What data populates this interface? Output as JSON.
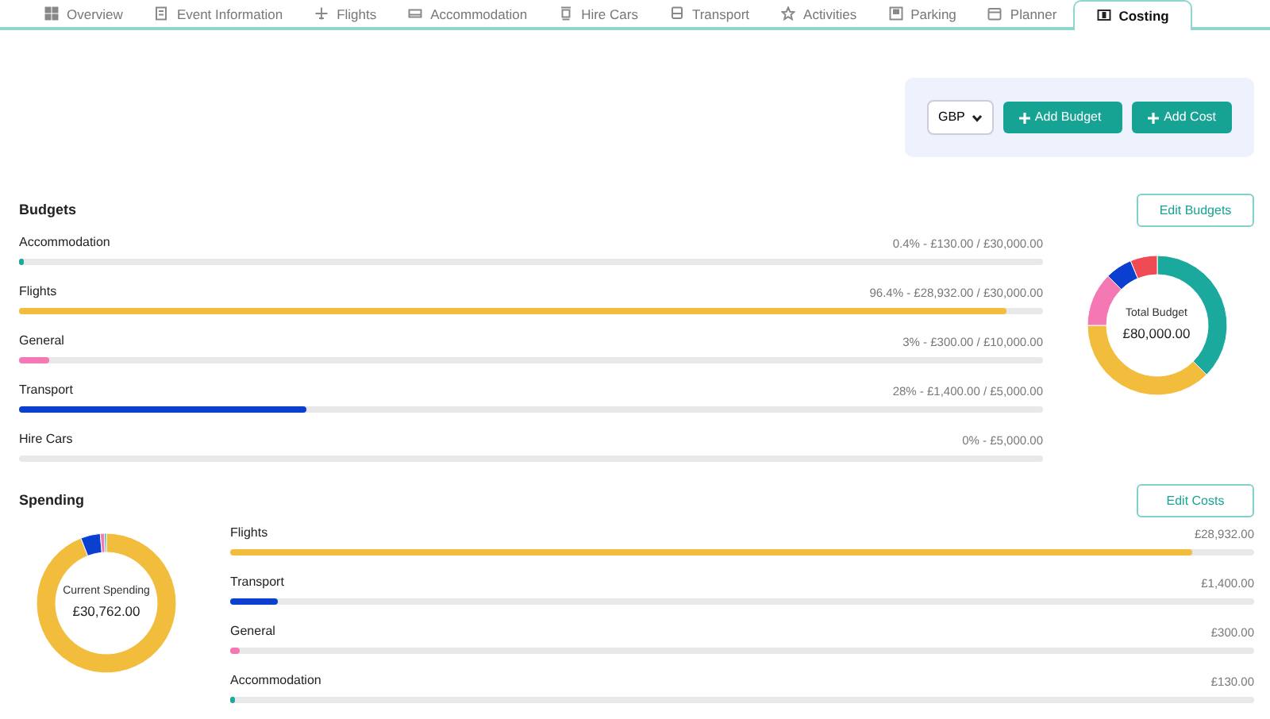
{
  "tabs": [
    {
      "label": "Overview",
      "selected": false
    },
    {
      "label": "Event Information",
      "selected": false
    },
    {
      "label": "Flights",
      "selected": false
    },
    {
      "label": "Accommodation",
      "selected": false
    },
    {
      "label": "Hire Cars",
      "selected": false
    },
    {
      "label": "Transport",
      "selected": false
    },
    {
      "label": "Activities",
      "selected": false
    },
    {
      "label": "Parking",
      "selected": false
    },
    {
      "label": "Planner",
      "selected": false
    },
    {
      "label": "Costing",
      "selected": true
    }
  ],
  "toolbar": {
    "currency": "GBP",
    "buttons": [
      "Add Budget",
      "Add Cost"
    ]
  },
  "budgets": {
    "title": "Budgets",
    "edit_button": "Edit Budgets",
    "items": [
      {
        "name": "Accommodation",
        "summary": "0.4% - £130.00 / £30,000.00",
        "level": 0.004,
        "color": "#1aa99c"
      },
      {
        "name": "Flights",
        "summary": "96.4% - £28,932.00 / £30,000.00",
        "level": 0.964,
        "color": "#f2bd3c"
      },
      {
        "name": "General",
        "summary": "3% - £300.00 / £10,000.00",
        "level": 0.03,
        "color": "#f478b4"
      },
      {
        "name": "Transport",
        "summary": "28% - £1,400.00 / £5,000.00",
        "level": 0.28,
        "color": "#0a3fcf"
      },
      {
        "name": "Hire Cars",
        "summary": "0% - £5,000.00",
        "level": 0,
        "color": "#f04a55"
      }
    ],
    "donut_label": "Total Budget",
    "donut_value": "£80,000.00",
    "chart_data": {
      "type": "donut",
      "values": [
        37.5,
        37.5,
        12.5,
        6.25,
        6.25
      ]
    }
  },
  "spending": {
    "title": "Spending",
    "edit_button": "Edit Costs",
    "donut_label": "Current Spending",
    "donut_value": "£30,762.00",
    "items": [
      {
        "name": "Flights",
        "amount": "£28,932.00",
        "level": 0.94,
        "color": "#f2bd3c"
      },
      {
        "name": "Transport",
        "amount": "£1,400.00",
        "level": 0.046,
        "color": "#0a3fcf"
      },
      {
        "name": "General",
        "amount": "£300.00",
        "level": 0.01,
        "color": "#f478b4"
      },
      {
        "name": "Accommodation",
        "amount": "£130.00",
        "level": 0.004,
        "color": "#1aa99c"
      }
    ],
    "chart_data": {
      "type": "donut",
      "values": [
        94.05,
        4.55,
        0.98,
        0.42
      ]
    }
  }
}
